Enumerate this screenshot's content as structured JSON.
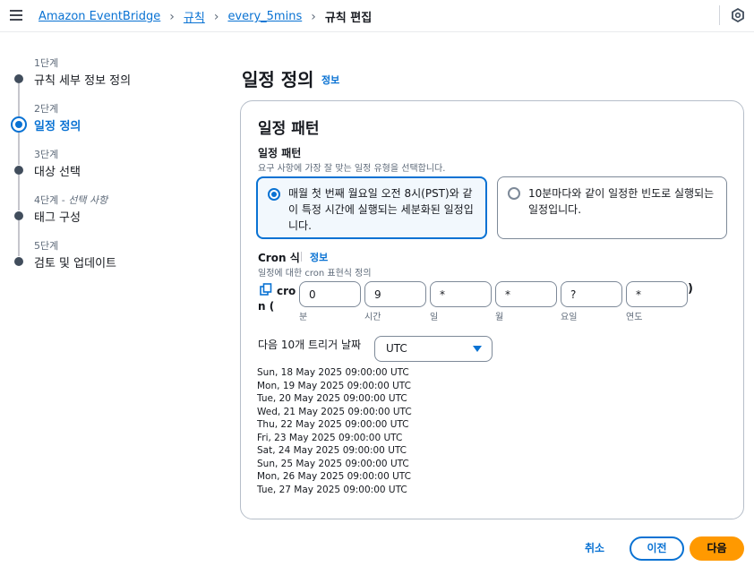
{
  "breadcrumb": {
    "items": [
      "Amazon EventBridge",
      "규칙",
      "every_5mins"
    ],
    "current": "규칙 편집"
  },
  "icons": {
    "menu": "hamburger-menu-icon",
    "separator": "chevron-right-icon",
    "feedback": "hexagon-feedback-icon",
    "copy": "copy-icon",
    "dropdown": "caret-down-icon"
  },
  "steps": [
    {
      "num": "1단계",
      "label": "규칙 세부 정보 정의"
    },
    {
      "num": "2단계",
      "label": "일정 정의"
    },
    {
      "num": "3단계",
      "label": "대상 선택"
    },
    {
      "num": "4단계",
      "optional": "선택 사항",
      "label": "태그 구성"
    },
    {
      "num": "5단계",
      "label": "검토 및 업데이트"
    }
  ],
  "active_step": 2,
  "page": {
    "title": "일정 정의",
    "info": "정보"
  },
  "card": {
    "title": "일정 패턴",
    "pattern_label": "일정 패턴",
    "pattern_desc": "요구 사항에 가장 잘 맞는 일정 유형을 선택합니다.",
    "options": [
      {
        "text": "매월 첫 번째 월요일 오전 8시(PST)와 같이 특정 시간에 실행되는 세분화된 일정입니다.",
        "selected": true
      },
      {
        "text": "10분마다와 같이 일정한 빈도로 실행되는 일정입니다.",
        "selected": false
      }
    ],
    "cron_label": "Cron 식",
    "cron_info": "정보",
    "cron_desc": "일정에 대한 cron 표현식 정의",
    "cron_prefix_1": "cro",
    "cron_prefix_2": "n (",
    "cron_close": ")",
    "cron_fields": [
      {
        "value": "0",
        "caption": "분"
      },
      {
        "value": "9",
        "caption": "시간"
      },
      {
        "value": "*",
        "caption": "일"
      },
      {
        "value": "*",
        "caption": "월"
      },
      {
        "value": "?",
        "caption": "요일"
      },
      {
        "value": "*",
        "caption": "연도"
      }
    ],
    "trigger_label": "다음 10개 트리거 날짜",
    "timezone": "UTC",
    "trigger_dates": [
      "Sun, 18 May 2025 09:00:00 UTC",
      "Mon, 19 May 2025 09:00:00 UTC",
      "Tue, 20 May 2025 09:00:00 UTC",
      "Wed, 21 May 2025 09:00:00 UTC",
      "Thu, 22 May 2025 09:00:00 UTC",
      "Fri, 23 May 2025 09:00:00 UTC",
      "Sat, 24 May 2025 09:00:00 UTC",
      "Sun, 25 May 2025 09:00:00 UTC",
      "Mon, 26 May 2025 09:00:00 UTC",
      "Tue, 27 May 2025 09:00:00 UTC"
    ]
  },
  "footer": {
    "cancel": "취소",
    "previous": "이전",
    "next": "다음"
  },
  "colors": {
    "link": "#0972d3",
    "primary_button": "#ff9900",
    "step_dot": "#414d5c"
  }
}
